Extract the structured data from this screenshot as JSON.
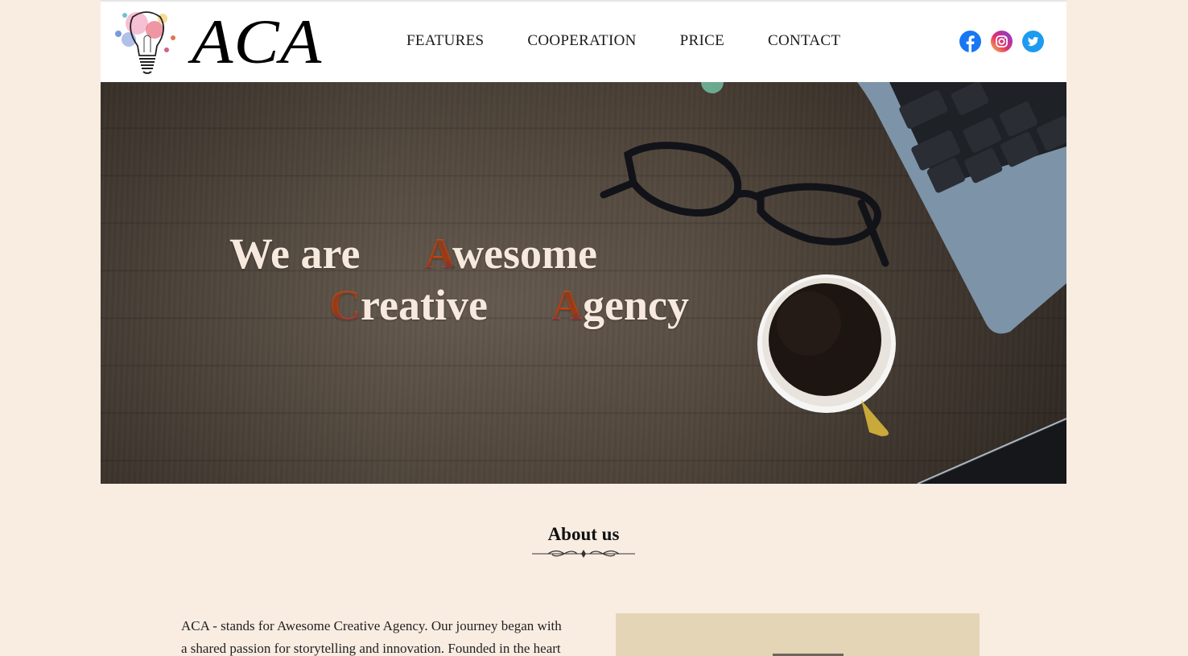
{
  "header": {
    "logo_text": "ACA",
    "nav": [
      "FEATURES",
      "COOPERATION",
      "PRICE",
      "CONTACT"
    ],
    "social": [
      {
        "name": "facebook-icon",
        "color": "#1877f2"
      },
      {
        "name": "instagram-icon",
        "color": "#e1306c"
      },
      {
        "name": "twitter-icon",
        "color": "#1d9bf0"
      }
    ]
  },
  "hero": {
    "line1_word1": "We are",
    "line1_word2_first": "A",
    "line1_word2_rest": "wesome",
    "line2_word1_first": "C",
    "line2_word1_rest": "reative",
    "line2_word2_first": "A",
    "line2_word2_rest": "gency",
    "accent_color": "#d8551c"
  },
  "about": {
    "title": "About us",
    "text_line1": "ACA - stands for Awesome Creative Agency. Our journey began with",
    "text_line2": "a shared passion for storytelling and innovation. Founded in the heart"
  },
  "colors": {
    "background": "#f9ede2",
    "header": "#ffffff",
    "image_placeholder": "#e3d5b6"
  }
}
